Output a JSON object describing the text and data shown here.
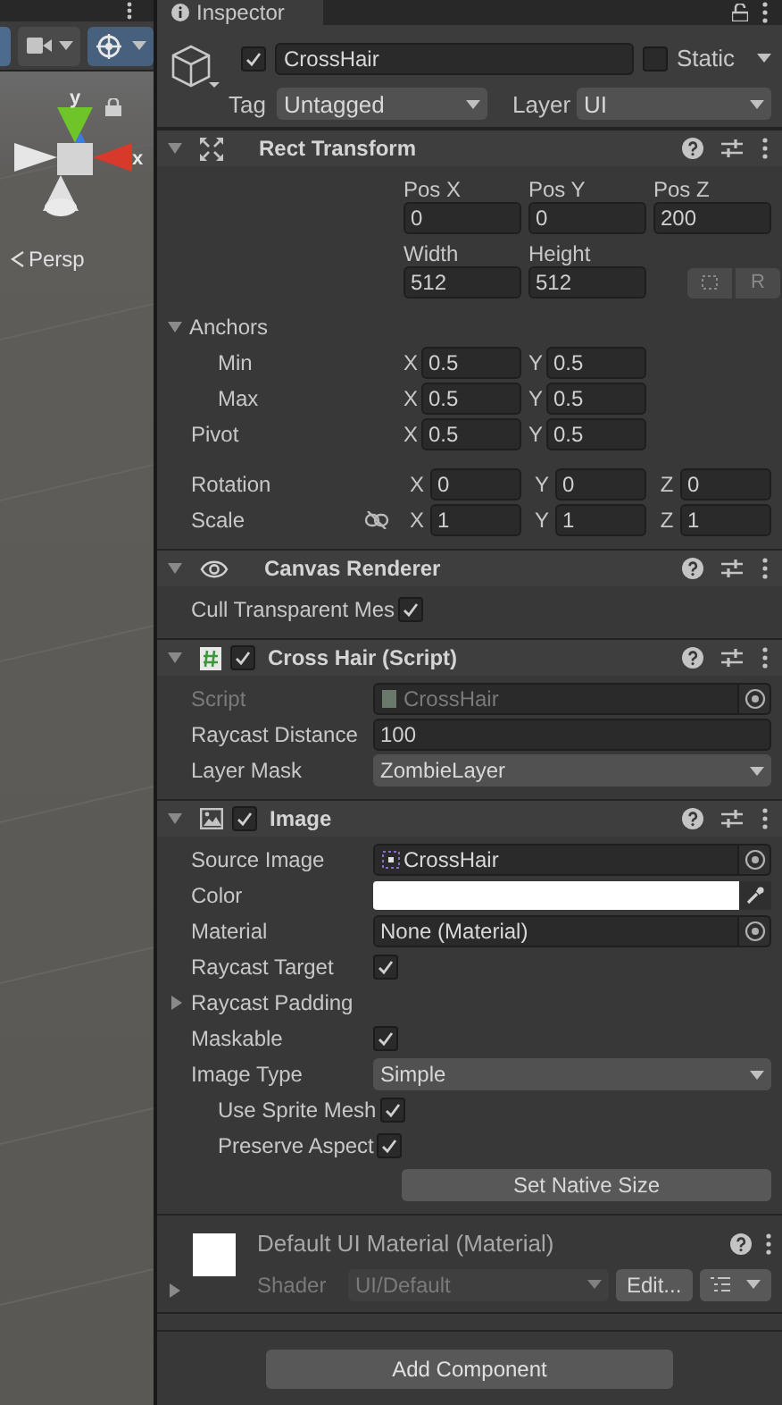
{
  "scene_view": {
    "axis_labels": [
      "y",
      "x"
    ],
    "projection": "Persp"
  },
  "inspector": {
    "tab": "Inspector",
    "object": {
      "active": true,
      "name": "CrossHair",
      "static_label": "Static",
      "static": false,
      "tag_label": "Tag",
      "tag": "Untagged",
      "layer_label": "Layer",
      "layer": "UI"
    },
    "components": [
      {
        "kind": "rect_transform",
        "title": "Rect Transform",
        "expanded": true,
        "position": {
          "labels": [
            "Pos X",
            "Pos Y",
            "Pos Z"
          ],
          "values": [
            "0",
            "0",
            "200"
          ]
        },
        "size": {
          "labels": [
            "Width",
            "Height"
          ],
          "values": [
            "512",
            "512"
          ],
          "raw_button": "R"
        },
        "vectors": [
          {
            "kind": "foldout",
            "label": "Anchors",
            "expanded": true,
            "indent": false
          },
          {
            "kind": "vector2",
            "label": "Min",
            "indent": true,
            "fields": [
              {
                "axis": "X",
                "value": "0.5"
              },
              {
                "axis": "Y",
                "value": "0.5"
              }
            ]
          },
          {
            "kind": "vector2",
            "label": "Max",
            "indent": true,
            "fields": [
              {
                "axis": "X",
                "value": "0.5"
              },
              {
                "axis": "Y",
                "value": "0.5"
              }
            ]
          },
          {
            "kind": "vector2",
            "label": "Pivot",
            "indent": false,
            "fields": [
              {
                "axis": "X",
                "value": "0.5"
              },
              {
                "axis": "Y",
                "value": "0.5"
              }
            ]
          },
          {
            "kind": "vector3",
            "label": "Rotation",
            "indent": false,
            "fields": [
              {
                "axis": "X",
                "value": "0"
              },
              {
                "axis": "Y",
                "value": "0"
              },
              {
                "axis": "Z",
                "value": "0"
              }
            ]
          },
          {
            "kind": "vector3",
            "label": "Scale",
            "indent": false,
            "linked": false,
            "fields": [
              {
                "axis": "X",
                "value": "1"
              },
              {
                "axis": "Y",
                "value": "1"
              },
              {
                "axis": "Z",
                "value": "1"
              }
            ]
          }
        ]
      },
      {
        "kind": "canvas_renderer",
        "title": "Canvas Renderer",
        "expanded": true,
        "rows": [
          {
            "kind": "checkbox",
            "label": "Cull Transparent Mes",
            "checked": true,
            "indent": false
          }
        ]
      },
      {
        "kind": "script",
        "title": "Cross Hair (Script)",
        "expanded": true,
        "enabled": true,
        "rows": [
          {
            "kind": "script_field",
            "label": "Script",
            "value": "CrossHair",
            "disabled": true,
            "indent": false
          },
          {
            "kind": "text",
            "label": "Raycast Distance",
            "value": "100",
            "indent": false
          },
          {
            "kind": "dropdown",
            "label": "Layer Mask",
            "value": "ZombieLayer",
            "indent": false
          }
        ]
      },
      {
        "kind": "image",
        "title": "Image",
        "expanded": true,
        "enabled": true,
        "rows": [
          {
            "kind": "sprite_field",
            "label": "Source Image",
            "value": "CrossHair",
            "disabled": false,
            "indent": false
          },
          {
            "kind": "color",
            "label": "Color",
            "indent": false
          },
          {
            "kind": "object",
            "label": "Material",
            "value": "None (Material)",
            "disabled": false,
            "indent": false
          },
          {
            "kind": "checkbox",
            "label": "Raycast Target",
            "checked": true,
            "indent": false
          },
          {
            "kind": "foldout",
            "label": "Raycast Padding",
            "expanded": false,
            "indent": false
          },
          {
            "kind": "checkbox",
            "label": "Maskable",
            "checked": true,
            "indent": false
          },
          {
            "kind": "dropdown",
            "label": "Image Type",
            "value": "Simple",
            "indent": false
          },
          {
            "kind": "checkbox",
            "label": "Use Sprite Mesh",
            "checked": true,
            "indent": true
          },
          {
            "kind": "checkbox",
            "label": "Preserve Aspect",
            "checked": true,
            "indent": true
          },
          {
            "kind": "button",
            "label": "Set Native Size",
            "indent": false
          }
        ]
      }
    ],
    "material": {
      "title": "Default UI Material (Material)",
      "expanded": false,
      "shader_label": "Shader",
      "shader": "UI/Default",
      "edit_button": "Edit..."
    },
    "add_component": "Add Component"
  }
}
